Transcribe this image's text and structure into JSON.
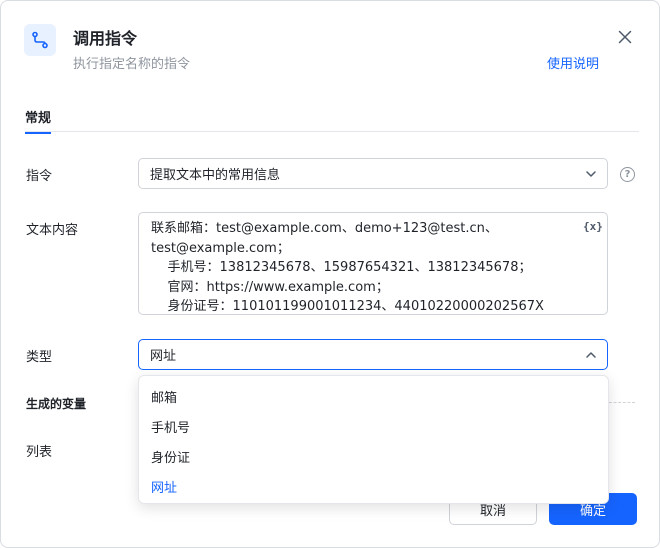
{
  "header": {
    "title": "调用指令",
    "subtitle": "执行指定名称的指令",
    "help_link": "使用说明"
  },
  "tabs": [
    {
      "label": "常规",
      "active": true
    }
  ],
  "form": {
    "command": {
      "label": "指令",
      "value": "提取文本中的常用信息"
    },
    "text_content": {
      "label": "文本内容",
      "value": "联系邮箱：test@example.com、demo+123@test.cn、\ntest@example.com；\n    手机号：13812345678、15987654321、13812345678；\n    官网：https://www.example.com；\n    身份证号：110101199001011234、44010220000202567X",
      "var_button": "{x}"
    },
    "type": {
      "label": "类型",
      "value": "网址"
    },
    "generated_vars": {
      "label": "生成的变量"
    },
    "list": {
      "label": "列表"
    }
  },
  "dropdown": {
    "options": [
      {
        "label": "邮箱",
        "selected": false
      },
      {
        "label": "手机号",
        "selected": false
      },
      {
        "label": "身份证",
        "selected": false
      },
      {
        "label": "网址",
        "selected": true
      }
    ]
  },
  "footer": {
    "cancel_label": "取消",
    "ok_label": "确定"
  },
  "icons": {
    "header": "route-icon",
    "close": "close-icon",
    "help": "question-circle-icon",
    "chevron_down": "chevron-down-icon",
    "chevron_up": "chevron-up-icon"
  },
  "colors": {
    "accent": "#1664ff",
    "icon_bg": "#e8f1ff",
    "muted_text": "#8f959e"
  }
}
